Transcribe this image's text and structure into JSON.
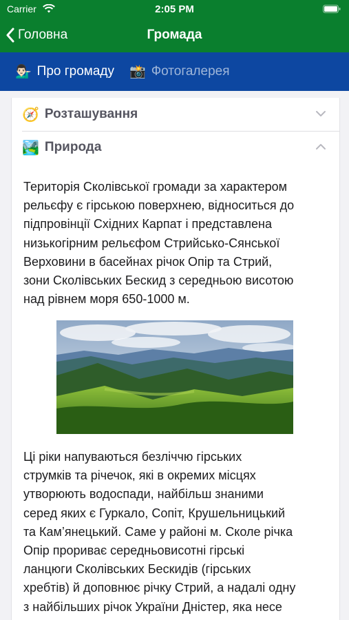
{
  "status_bar": {
    "carrier": "Carrier",
    "time": "2:05 PM",
    "icons": [
      "wifi-icon",
      "battery-icon"
    ]
  },
  "nav_bar": {
    "back_label": "Головна",
    "title": "Громада"
  },
  "tabs": [
    {
      "emoji": "💁🏻‍♂️",
      "label": "Про громаду",
      "active": true
    },
    {
      "emoji": "📸",
      "label": "Фотогалерея",
      "active": false
    }
  ],
  "sections": [
    {
      "emoji": "🧭",
      "title": "Розташування",
      "expanded": false
    },
    {
      "emoji": "🏞️",
      "title": "Природа",
      "expanded": true
    }
  ],
  "nature": {
    "paragraph_1": [
      "Територія Сколівської громади за характером",
      "рельєфу є гірською поверхнею, відноситься до",
      "підпровінції Східних Карпат і представлена",
      "низькогірним рельєфом Стрийсько-Сянської",
      "Верховини в басейнах річок Опір та Стрий,",
      "зони Сколівських Бескид з середньою висотою",
      "над рівнем моря 650-1000 м."
    ],
    "paragraph_2": [
      "Ці ріки напуваються безліччю гірських",
      "струмків та річечок, які в окремих місцях",
      "утворюють водоспади, найбільш знаними",
      "серед яких є Гуркало, Сопіт, Крушельницький",
      "та Кам’янецький. Саме у районі м. Сколе річка",
      "Опір прориває середньовисотні гірські",
      "ланцюги Сколівських  Бескидів (гірських",
      "хребтів) й доповнює річку Стрий, а надалі одну",
      "з найбільших річок України Дністер, яка несе"
    ]
  },
  "colors": {
    "nav_green": "#0a7f2e",
    "tab_blue": "#0d47a1",
    "tab_inactive": "#9fb6d9",
    "section_title": "#555560"
  }
}
